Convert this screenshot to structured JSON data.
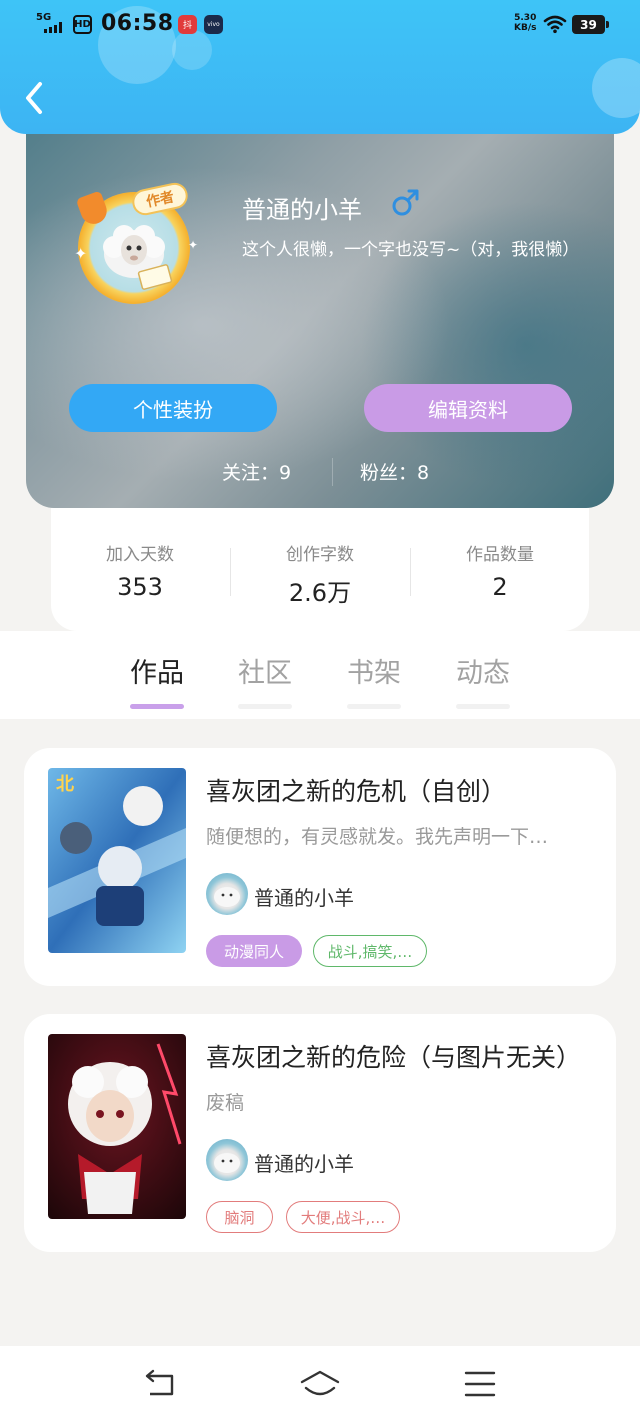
{
  "status_bar": {
    "network": "5G",
    "hd": "HD",
    "time": "06:58",
    "app1": "抖",
    "app2": "vivo",
    "speed_value": "5.30",
    "speed_unit": "KB/s",
    "battery": "39"
  },
  "profile": {
    "author_tag": "作者",
    "nickname": "普通的小羊",
    "gender": "male",
    "bio": "这个人很懒，一个字也没写~（对，我很懒）",
    "dress_button": "个性装扮",
    "edit_button": "编辑资料",
    "follow_text": "关注：9",
    "fans_text": "粉丝：8"
  },
  "stats": [
    {
      "label": "加入天数",
      "value": "353"
    },
    {
      "label": "创作字数",
      "value": "2.6万"
    },
    {
      "label": "作品数量",
      "value": "2"
    }
  ],
  "tabs": [
    {
      "label": "作品",
      "active": true
    },
    {
      "label": "社区",
      "active": false
    },
    {
      "label": "书架",
      "active": false
    },
    {
      "label": "动态",
      "active": false
    }
  ],
  "works": [
    {
      "title": "喜灰团之新的危机（自创）",
      "desc": "随便想的，有灵感就发。我先声明一下…",
      "author": "普通的小羊",
      "tags": [
        {
          "text": "动漫同人",
          "style": "filled",
          "color": "#c99be6"
        },
        {
          "text": "战斗,搞笑,…",
          "style": "outline",
          "color": "#5fb86a"
        }
      ]
    },
    {
      "title": "喜灰团之新的危险（与图片无关）",
      "desc": "废稿",
      "author": "普通的小羊",
      "tags": [
        {
          "text": "脑洞",
          "style": "outline",
          "color": "#e27c7c"
        },
        {
          "text": "大便,战斗,…",
          "style": "outline",
          "color": "#e27c7c"
        }
      ]
    }
  ],
  "colors": {
    "header": "#3ec4f7",
    "dress_button": "#33a8f5",
    "edit_button": "#c99be6",
    "active_tab_bar": "#c9a0ea"
  },
  "icons": {
    "back": "chevron-left-icon",
    "gender": "male-icon",
    "nav_back": "back-arrow-icon",
    "nav_home": "home-icon",
    "nav_menu": "menu-icon"
  }
}
